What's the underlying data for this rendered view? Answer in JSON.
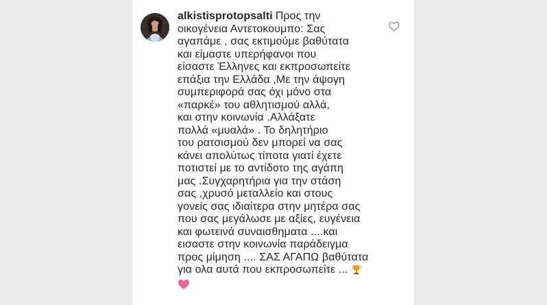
{
  "comment": {
    "username": "alkistisprotopsalti",
    "lines": [
      "Προς την",
      "οικογένεια Αντετοκουμπο: Σας",
      "αγαπάμε , σας εκτιμούμε βαθύτατα",
      "και είμαστε υπερήφανοι που",
      "είσαστε Έλληνες και εκπροσωπείτε",
      "επάξια την Ελλάδα ,Με την άψογη",
      "συμπεριφορά σας όχι μόνο στα",
      "«παρκέ» του αθλητισμού αλλά,",
      "και στην κοινωνία .Αλλάξατε",
      "πολλά «μυαλά» . Το δηλητήριο",
      "του ρατσισμού δεν μπορεί να σας",
      "κάνει απολύτως τίποτα γιατί έχετε",
      "ποτιστεί με το αντίδοτο της αγάπη",
      "μας .Συγχαρητήρια για την στάση",
      "σας ,χρυσό μεταλλείο και στους",
      "γονείς σας ιδιαίτερα στην μητέρα σας",
      "που σας μεγάλωσε με αξίες, ευγένεια",
      "και φωτεινά συναισθηματα ....και",
      "εισαστε στην κοινωνία παράδειγμα",
      "προς μίμηση .... ΣΑΣ ΑΓΑΠΩ  βαθύτατα",
      "για ολα αυτά που εκπροσωπείτε ..."
    ],
    "emojis": {
      "trophy": "trophy-emoji",
      "heart": "pink-heart-emoji"
    }
  },
  "icons": {
    "like": "heart-outline-icon",
    "avatar": "profile-avatar"
  },
  "colors": {
    "text": "#262626",
    "background": "#ffffff",
    "side": "#e9e9e9",
    "heart_emoji": "#e7668f",
    "trophy": "#d9a21b"
  }
}
